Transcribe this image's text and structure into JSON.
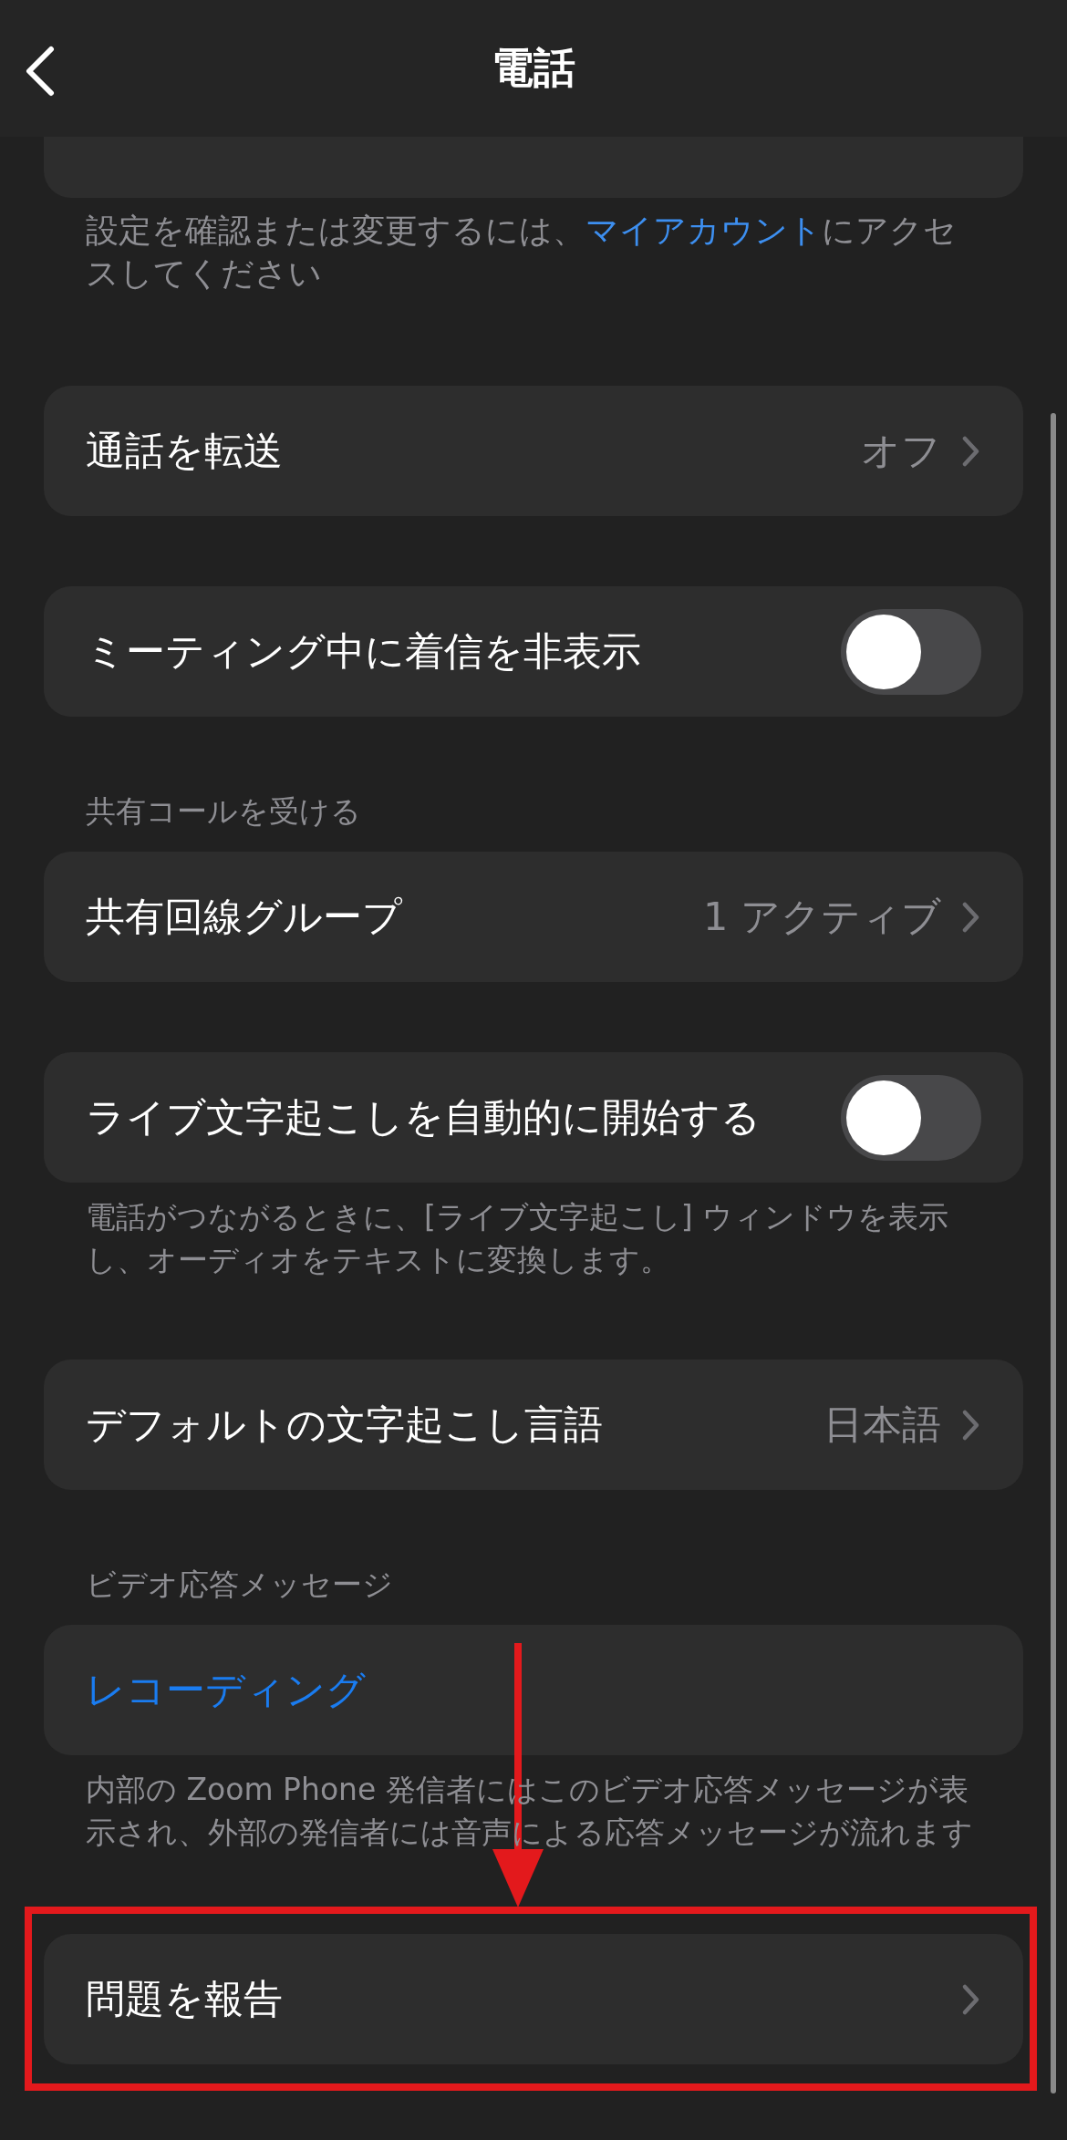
{
  "header": {
    "title": "電話"
  },
  "items": [
    {
      "kind": "cut_row"
    },
    {
      "kind": "note",
      "text": "設定を確認または変更するには、",
      "link": "マイアカウント",
      "text_after": "にアクセスしてください"
    },
    {
      "kind": "row",
      "label": "通話を転送",
      "value": "オフ"
    },
    {
      "kind": "toggle",
      "label": "ミーティング中に着信を非表示",
      "on": false
    },
    {
      "kind": "section",
      "text": "共有コールを受ける"
    },
    {
      "kind": "row",
      "label": "共有回線グループ",
      "value": "1 アクティブ"
    },
    {
      "kind": "toggle",
      "label": "ライブ文字起こしを自動的に開始する",
      "on": false
    },
    {
      "kind": "note",
      "text": "電話がつながるときに、[ライブ文字起こし] ウィンドウを表示し、オーディオをテキストに変換します。"
    },
    {
      "kind": "row",
      "label": "デフォルトの文字起こし言語",
      "value": "日本語"
    },
    {
      "kind": "section",
      "text": "ビデオ応答メッセージ"
    },
    {
      "kind": "action",
      "label": "レコーディング"
    },
    {
      "kind": "note",
      "text": "内部の Zoom Phone 発信者にはこのビデオ応答メッセージが表示され、外部の発信者には音声による応答メッセージが流れます"
    },
    {
      "kind": "row",
      "label": "問題を報告",
      "highlighted": true
    }
  ]
}
